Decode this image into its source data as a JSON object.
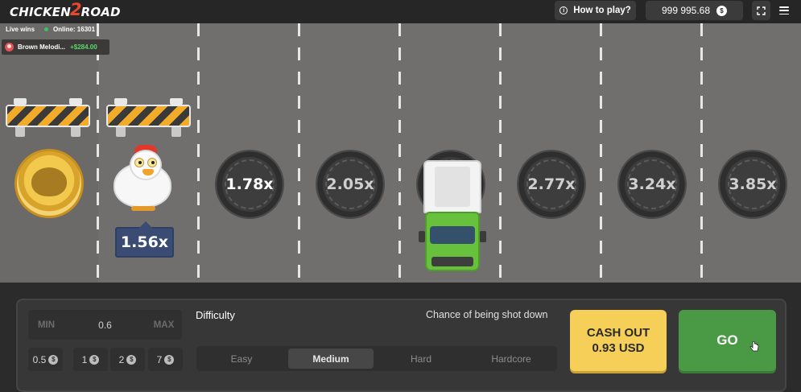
{
  "brand": {
    "logo_left": "CHICKEN",
    "logo_mid": "2",
    "logo_right": "ROAD"
  },
  "header": {
    "how_to_play": "How to play?",
    "info_icon": "info-icon",
    "balance": "999 995.68",
    "currency_symbol": "$",
    "expand_icon": "expand-icon",
    "menu_icon": "hamburger-menu-icon"
  },
  "live": {
    "label": "Live wins",
    "online": "Online: 16301",
    "wins": [
      {
        "name": "Brown Melodi...",
        "amount": "+$284.00"
      }
    ]
  },
  "road": {
    "current_multiplier": "1.56x",
    "lane_multipliers": [
      "1.78x",
      "2.05x",
      "2.77x",
      "3.24x",
      "3.85x"
    ]
  },
  "controls": {
    "min_label": "MIN",
    "bet_value": "0.6",
    "max_label": "MAX",
    "quick_bets": [
      "0.5",
      "1",
      "2",
      "7"
    ],
    "difficulty_label": "Difficulty",
    "chance_label": "Chance of being shot down",
    "difficulties": [
      "Easy",
      "Medium",
      "Hard",
      "Hardcore"
    ],
    "selected_difficulty": "Medium",
    "cashout_line1": "CASH OUT",
    "cashout_line2": "0.93 USD",
    "go_label": "GO"
  },
  "colors": {
    "road": "#716e6e",
    "panel": "#373737",
    "cashout": "#f5cf58",
    "go": "#4a9a45",
    "badge": "#3a4c73",
    "win_amount": "#59d96b",
    "logo_accent": "#e9482f"
  }
}
